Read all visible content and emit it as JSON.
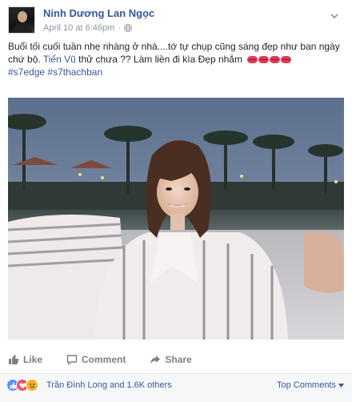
{
  "post": {
    "author": "Ninh Dương Lan Ngọc",
    "timestamp": "April 10 at 6:46pm",
    "privacy_icon": "globe-icon",
    "text_part1": "Buổi tối cuối tuần nhẹ nhàng ở nhà....tớ tự chụp cũng sáng đẹp như ban ngày chứ bộ.",
    "mention": "Tiến Vũ",
    "text_part2": "thử chưa ?? Làm liền đi kìa Đẹp nhắm",
    "emoji_icon": "kiss-lips-icon",
    "hashtags": [
      "#s7edge",
      "#s7thachban"
    ]
  },
  "actions": {
    "like": "Like",
    "comment": "Comment",
    "share": "Share"
  },
  "reactions": {
    "summary": "Trần Đình Long and 1.6K others",
    "sort_label": "Top Comments"
  },
  "colors": {
    "link": "#365899",
    "action_gray": "#7f7f7f",
    "like_blue": "#5890ff",
    "love_red": "#f25268",
    "sad_yellow": "#f7b125"
  }
}
